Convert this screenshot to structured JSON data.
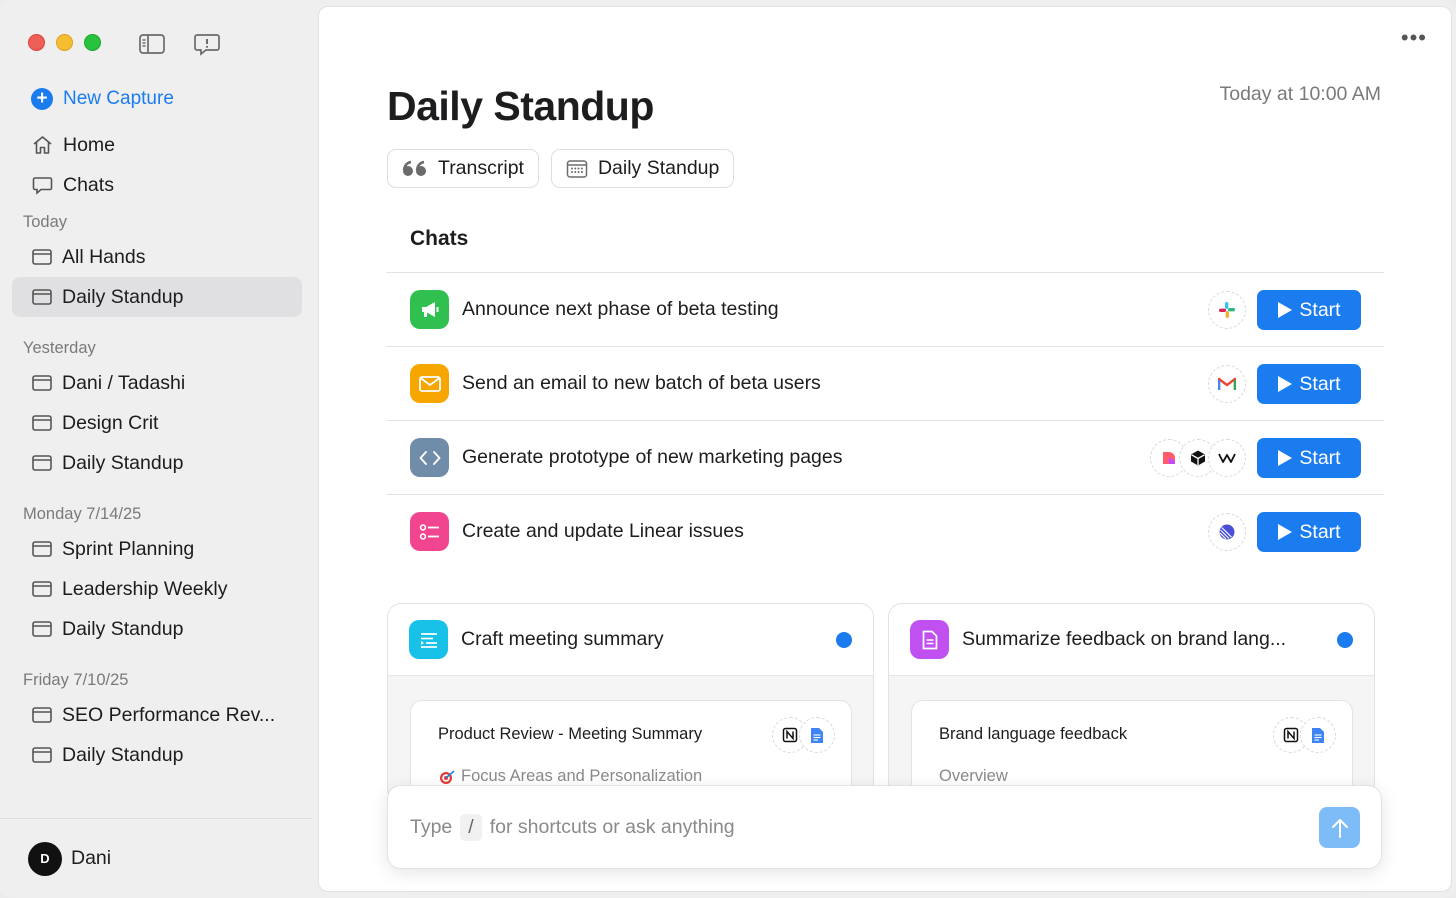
{
  "sidebar": {
    "new_capture": "New Capture",
    "primary": [
      {
        "label": "Home",
        "icon": "home-icon"
      },
      {
        "label": "Chats",
        "icon": "chat-bubble-icon"
      }
    ],
    "sections": [
      {
        "title": "Today",
        "items": [
          "All Hands",
          "Daily Standup"
        ]
      },
      {
        "title": "Yesterday",
        "items": [
          "Dani / Tadashi",
          "Design Crit",
          "Daily Standup"
        ]
      },
      {
        "title": "Monday 7/14/25",
        "items": [
          "Sprint Planning",
          "Leadership Weekly",
          "Daily Standup"
        ]
      },
      {
        "title": "Friday 7/10/25",
        "items": [
          "SEO Performance Rev...",
          "Daily Standup"
        ]
      }
    ],
    "active_item": "Daily Standup",
    "user": {
      "initial": "D",
      "name": "Dani"
    }
  },
  "main": {
    "title": "Daily Standup",
    "timestamp": "Today at 10:00 AM",
    "chips": [
      {
        "label": "Transcript",
        "icon": "quote-icon"
      },
      {
        "label": "Daily Standup",
        "icon": "calendar-icon"
      }
    ],
    "chats_title": "Chats",
    "chats": [
      {
        "label": "Announce next phase of beta testing",
        "icon": "megaphone-icon",
        "color": "#30c04f",
        "integrations": [
          "slack-icon"
        ],
        "button": "Start"
      },
      {
        "label": "Send an email to new batch of beta users",
        "icon": "envelope-icon",
        "color": "#f7a600",
        "integrations": [
          "gmail-icon"
        ],
        "button": "Start"
      },
      {
        "label": "Generate prototype of new marketing pages",
        "icon": "code-icon",
        "color": "#6f8ca8",
        "integrations": [
          "lovable-icon",
          "cube-icon",
          "windsurf-icon"
        ],
        "button": "Start"
      },
      {
        "label": "Create and update Linear issues",
        "icon": "checklist-icon",
        "color": "#f2458f",
        "integrations": [
          "linear-icon"
        ],
        "button": "Start"
      }
    ],
    "cards": [
      {
        "title": "Craft meeting summary",
        "icon": "summary-icon",
        "color": "#17c1e8",
        "doc_title": "Product Review - Meeting Summary",
        "doc_sub": "Focus Areas and Personalization",
        "doc_sub_icon": "target-icon"
      },
      {
        "title": "Summarize feedback on brand lang...",
        "icon": "document-icon",
        "color": "#c150f0",
        "doc_title": "Brand language feedback",
        "doc_sub": "Overview",
        "doc_sub_icon": ""
      }
    ],
    "composer": {
      "before": "Type",
      "slash": "/",
      "after": "for shortcuts or ask anything"
    }
  }
}
